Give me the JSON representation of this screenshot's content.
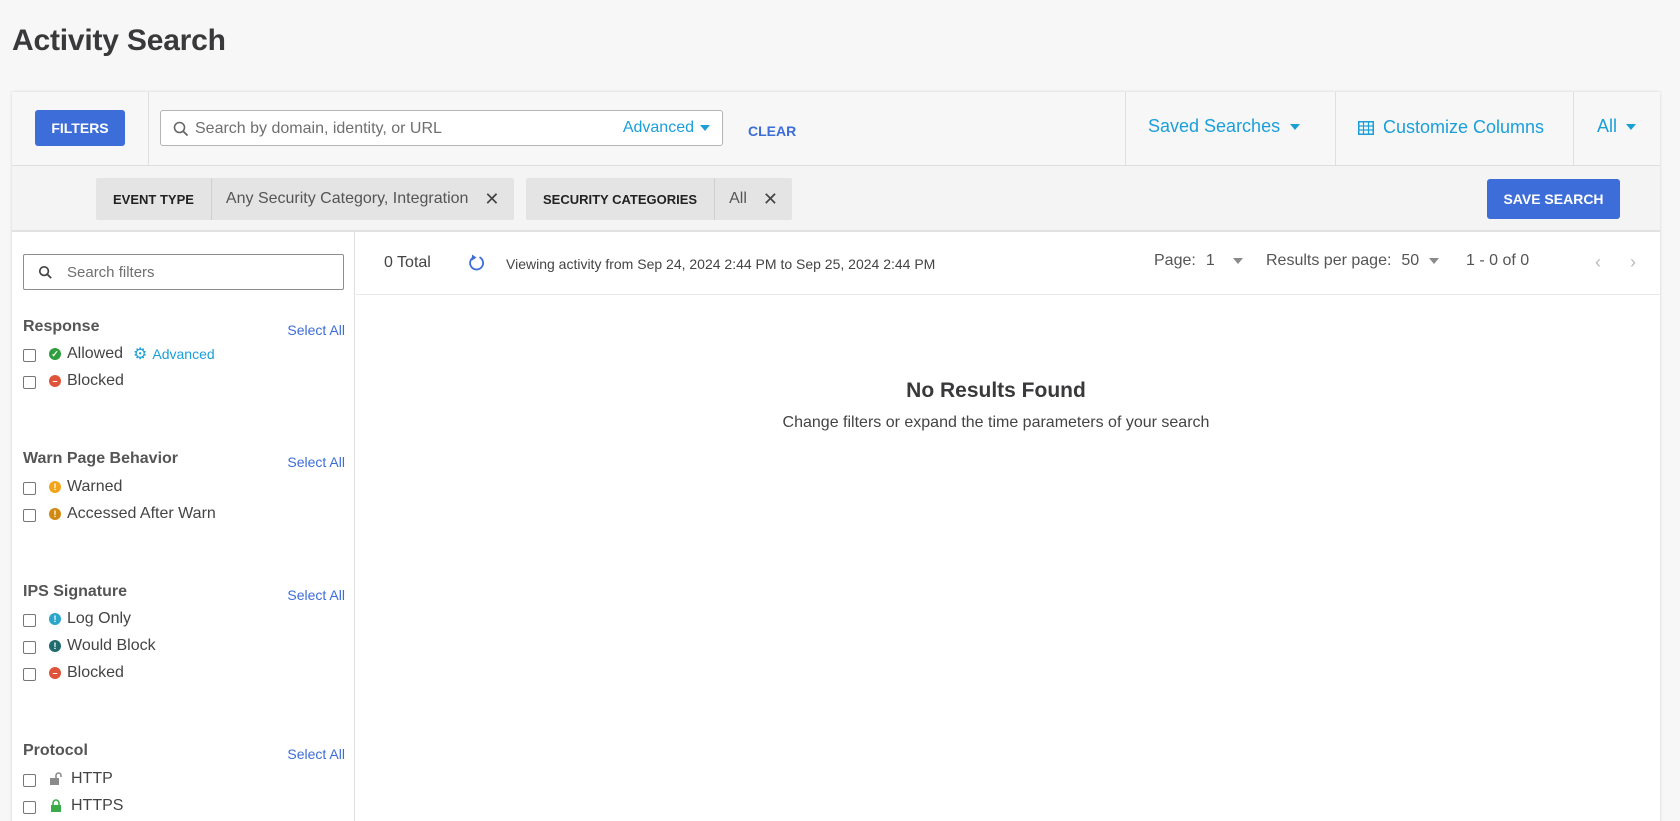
{
  "page": {
    "title": "Activity Search"
  },
  "toolbar": {
    "filters_label": "FILTERS",
    "search_placeholder": "Search by domain, identity, or URL",
    "advanced_label": "Advanced",
    "clear_label": "CLEAR",
    "saved_searches_label": "Saved Searches",
    "customize_columns_label": "Customize Columns",
    "all_label": "All"
  },
  "chips": [
    {
      "key": "EVENT TYPE",
      "value": "Any Security Category, Integration"
    },
    {
      "key": "SECURITY CATEGORIES",
      "value": "All"
    }
  ],
  "save_search_label": "SAVE SEARCH",
  "sidebar": {
    "search_placeholder": "Search filters",
    "select_all_label": "Select All",
    "groups": [
      {
        "title": "Response",
        "items": [
          {
            "label": "Allowed",
            "icon": "check-circle-icon",
            "color": "#2e9e3e",
            "extra": "Advanced"
          },
          {
            "label": "Blocked",
            "icon": "minus-circle-icon",
            "color": "#e0533b"
          }
        ]
      },
      {
        "title": "Warn Page Behavior",
        "items": [
          {
            "label": "Warned",
            "icon": "warning-circle-icon",
            "color": "#f2a41b"
          },
          {
            "label": "Accessed After Warn",
            "icon": "warning-circle-icon",
            "color": "#d08a12"
          }
        ]
      },
      {
        "title": "IPS Signature",
        "items": [
          {
            "label": "Log Only",
            "icon": "info-circle-icon",
            "color": "#29a6c9"
          },
          {
            "label": "Would Block",
            "icon": "alert-circle-icon",
            "color": "#1f6b6e"
          },
          {
            "label": "Blocked",
            "icon": "minus-circle-icon",
            "color": "#e0533b"
          }
        ]
      },
      {
        "title": "Protocol",
        "items": [
          {
            "label": "HTTP",
            "icon": "unlock-icon",
            "color": "#8a8a8a"
          },
          {
            "label": "HTTPS",
            "icon": "lock-icon",
            "color": "#3cab4a"
          }
        ]
      }
    ]
  },
  "results": {
    "total": "0 Total",
    "viewing": "Viewing activity from Sep 24, 2024 2:44 PM to Sep 25, 2024 2:44 PM",
    "page_label": "Page:",
    "page_value": "1",
    "per_page_label": "Results per page:",
    "per_page_value": "50",
    "range": "1 - 0 of 0",
    "empty_title": "No Results Found",
    "empty_sub": "Change filters or expand the time parameters of your search"
  }
}
